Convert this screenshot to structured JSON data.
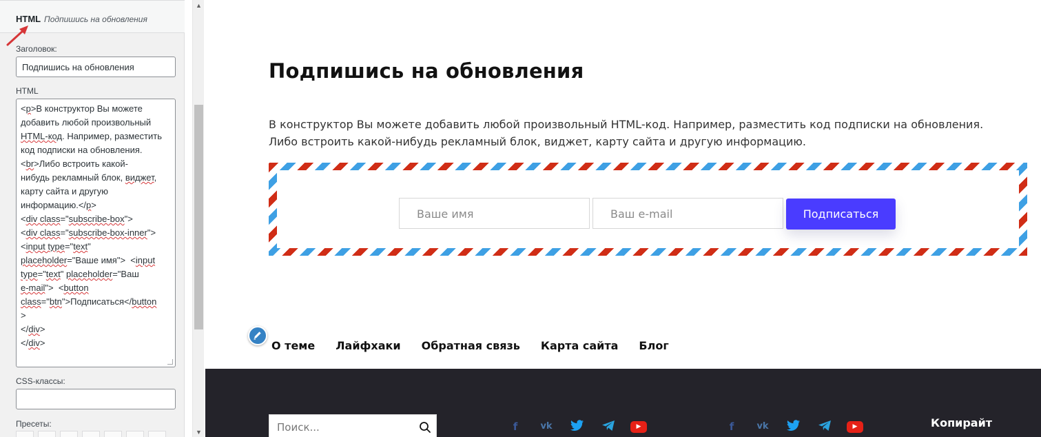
{
  "widget": {
    "type_label": "HTML",
    "name": "Подпишись на обновления",
    "title_label": "Заголовок:",
    "title_value": "Подпишись на обновления",
    "html_label": "HTML",
    "code": {
      "l1_a": "<",
      "l1_b": "p",
      "l1_c": ">В конструктор Вы можете",
      "l2": "добавить любой произвольный",
      "l3_a": "HTML-код",
      "l3_b": ". Например, разместить",
      "l4": "код подписки на обновления.",
      "l5_a": "<",
      "l5_b": "br",
      "l5_c": ">Либо встроить какой-",
      "l6_a": "нибудь рекламный блок, ",
      "l6_b": "виджет",
      "l6_c": ",",
      "l7": "карту сайта и другую",
      "l8_a": "информацию.</",
      "l8_b": "p",
      "l8_c": ">",
      "l9_a": "<",
      "l9_b": "div class",
      "l9_c": "=\"",
      "l9_d": "subscribe-box",
      "l9_e": "\">",
      "l10_a": "<",
      "l10_b": "div class",
      "l10_c": "=\"",
      "l10_d": "subscribe-box-inner",
      "l10_e": "\">",
      "l11_a": "<",
      "l11_b": "input type",
      "l11_c": "=\"",
      "l11_d": "text",
      "l11_e": "\"",
      "l12_a": "placeholder",
      "l12_b": "=\"Ваше имя\">  <",
      "l12_c": "input",
      "l13_a": "type",
      "l13_b": "=\"",
      "l13_c": "text",
      "l13_d": "\" ",
      "l13_e": "placeholder",
      "l13_f": "=\"Ваш",
      "l14_a": "e-mail",
      "l14_b": "\">  <",
      "l14_c": "button",
      "l15_a": "class",
      "l15_b": "=\"",
      "l15_c": "btn",
      "l15_d": "\">Подписаться</",
      "l15_e": "button",
      "l16": ">",
      "l17_a": "</",
      "l17_b": "div",
      "l17_c": ">",
      "l18_a": "</",
      "l18_b": "div",
      "l18_c": ">"
    },
    "css_label": "CSS-классы:",
    "css_value": "",
    "presets_label": "Пресеты:"
  },
  "preview": {
    "heading": "Подпишись на обновления",
    "paragraph_line1": "В конструктор Вы можете добавить любой произвольный HTML-код. Например, разместить код подписки на обновления.",
    "paragraph_line2": "Либо встроить какой-нибудь рекламный блок, виджет, карту сайта и другую информацию.",
    "name_placeholder": "Ваше имя",
    "email_placeholder": "Ваш e-mail",
    "subscribe_label": "Подписаться",
    "menu": [
      "О теме",
      "Лайфхаки",
      "Обратная связь",
      "Карта сайта",
      "Блог"
    ],
    "search_placeholder": "Поиск...",
    "social_icons": [
      "facebook-icon",
      "vk-icon",
      "twitter-icon",
      "telegram-icon",
      "youtube-icon"
    ],
    "copyright_heading": "Копирайт"
  },
  "colors": {
    "button": "#4a3cff",
    "stripe_red": "#d02d16",
    "stripe_blue": "#3ea0e4",
    "footer": "#24232a",
    "accent_arrow": "#d63638"
  }
}
